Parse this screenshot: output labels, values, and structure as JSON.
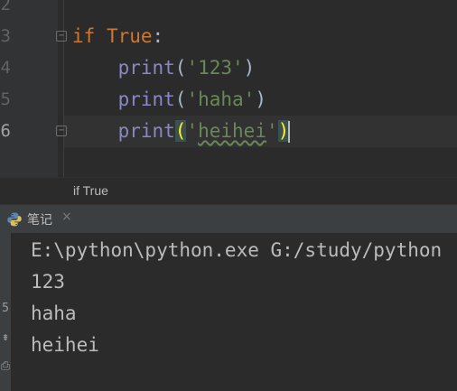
{
  "editor": {
    "line_numbers": [
      "2",
      "3",
      "4",
      "5",
      "6"
    ],
    "line3": {
      "keyword": "if",
      "space": " ",
      "value": "True",
      "colon": ":"
    },
    "line4": {
      "indent": "    ",
      "fn": "print",
      "open": "(",
      "str": "'123'",
      "close": ")"
    },
    "line5": {
      "indent": "    ",
      "fn": "print",
      "open": "(",
      "str": "'haha'",
      "close": ")"
    },
    "line6": {
      "indent": "    ",
      "fn": "print",
      "open": "(",
      "q1": "'",
      "word": "heihei",
      "q2": "'",
      "close": ")"
    }
  },
  "breadcrumb": {
    "text": "if True"
  },
  "run_panel": {
    "tab_label": "笔记",
    "tab_close": "×",
    "side_glyphs": [
      "5",
      "⇟",
      "⎙"
    ],
    "output": [
      "E:\\python\\python.exe G:/study/python",
      "123",
      "haha",
      "heihei"
    ]
  },
  "colors": {
    "keyword": "#cc7832",
    "builtin": "#8888c6",
    "string": "#6a8759",
    "brace_match": "#ffef28"
  },
  "icons": [
    "python-icon",
    "fold-icon",
    "close-icon"
  ]
}
